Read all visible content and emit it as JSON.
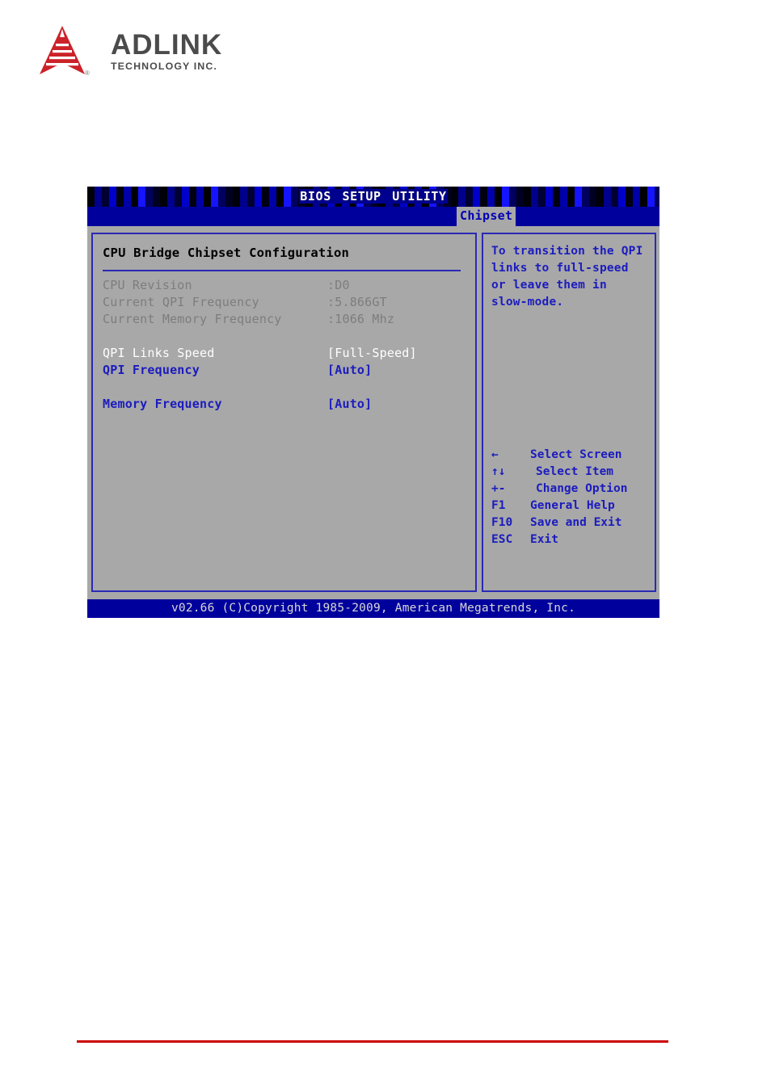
{
  "brand": {
    "name": "ADLINK",
    "tagline": "TECHNOLOGY INC.",
    "registered_mark": "®",
    "logo_color": "#cc2229",
    "wordmark_color": "#4b4b4b"
  },
  "bios": {
    "title": "BIOS SETUP UTILITY",
    "title_words": [
      "BIOS",
      "SETUP",
      "UTILITY"
    ],
    "active_tab": "Chipset",
    "section_title": "CPU Bridge Chipset Configuration",
    "info_rows": [
      {
        "label": "CPU Revision",
        "value": ":D0"
      },
      {
        "label": "Current QPI Frequency",
        "value": ":5.866GT"
      },
      {
        "label": "Current Memory Frequency",
        "value": ":1066 Mhz"
      }
    ],
    "option_rows": [
      {
        "label": "QPI Links Speed",
        "value": "[Full-Speed]",
        "state": "selected"
      },
      {
        "label": "QPI Frequency",
        "value": "[Auto]",
        "state": "normal"
      },
      {
        "label": "Memory Frequency",
        "value": "[Auto]",
        "state": "normal"
      }
    ],
    "help_text_lines": [
      "To transition the QPI",
      " links to full-speed",
      " or leave them in",
      " slow-mode."
    ],
    "key_legend": [
      {
        "key": "←",
        "desc": "Select Screen"
      },
      {
        "key": "↑↓",
        "desc": "Select Item"
      },
      {
        "key": "+-",
        "desc": "Change Option"
      },
      {
        "key": "F1",
        "desc": "General Help"
      },
      {
        "key": "F10",
        "desc": "Save and Exit"
      },
      {
        "key": "ESC",
        "desc": "Exit"
      }
    ],
    "footer": "v02.66 (C)Copyright 1985-2009, American Megatrends, Inc.",
    "colors": {
      "panel_bg": "#a8a8a8",
      "chrome_blue": "#00009c",
      "text_blue": "#1c1cbe",
      "dim_text": "#7d7d7d",
      "selected_text": "#ffffff",
      "accent_rule": "#cc0000"
    }
  }
}
